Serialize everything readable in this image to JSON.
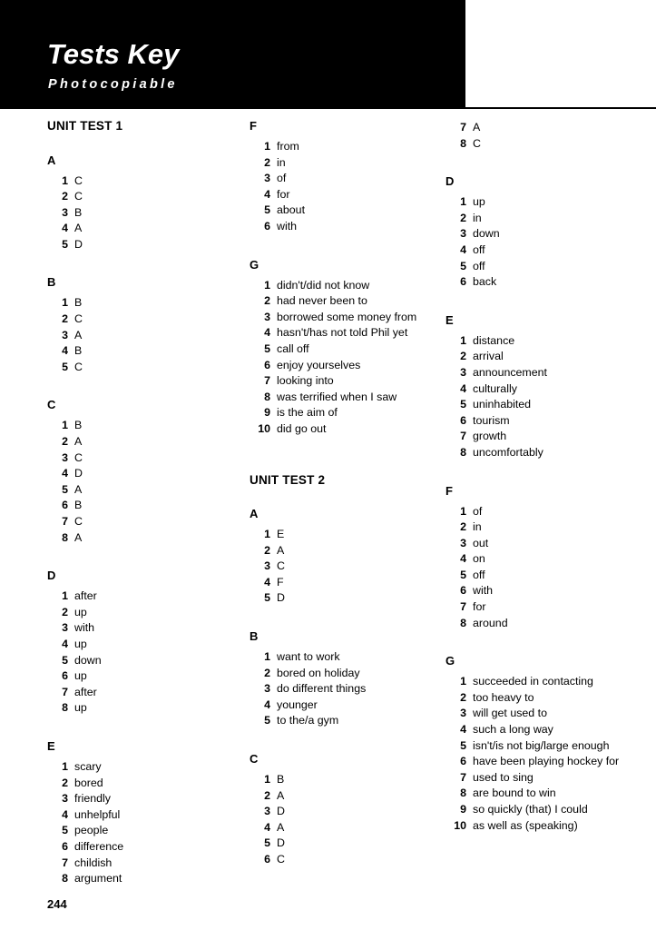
{
  "header": {
    "title": "Tests Key",
    "subtitle": "Photocopiable"
  },
  "page_number": "244",
  "columns": [
    {
      "blocks": [
        {
          "kind": "unit-heading",
          "label": "UNIT TEST 1"
        },
        {
          "kind": "section",
          "letter": "A",
          "items": [
            {
              "num": "1",
              "text": "C"
            },
            {
              "num": "2",
              "text": "C"
            },
            {
              "num": "3",
              "text": "B"
            },
            {
              "num": "4",
              "text": "A"
            },
            {
              "num": "5",
              "text": "D"
            }
          ]
        },
        {
          "kind": "section",
          "letter": "B",
          "items": [
            {
              "num": "1",
              "text": "B"
            },
            {
              "num": "2",
              "text": "C"
            },
            {
              "num": "3",
              "text": "A"
            },
            {
              "num": "4",
              "text": "B"
            },
            {
              "num": "5",
              "text": "C"
            }
          ]
        },
        {
          "kind": "section",
          "letter": "C",
          "items": [
            {
              "num": "1",
              "text": "B"
            },
            {
              "num": "2",
              "text": "A"
            },
            {
              "num": "3",
              "text": "C"
            },
            {
              "num": "4",
              "text": "D"
            },
            {
              "num": "5",
              "text": "A"
            },
            {
              "num": "6",
              "text": "B"
            },
            {
              "num": "7",
              "text": "C"
            },
            {
              "num": "8",
              "text": "A"
            }
          ]
        },
        {
          "kind": "section",
          "letter": "D",
          "items": [
            {
              "num": "1",
              "text": "after"
            },
            {
              "num": "2",
              "text": "up"
            },
            {
              "num": "3",
              "text": "with"
            },
            {
              "num": "4",
              "text": "up"
            },
            {
              "num": "5",
              "text": "down"
            },
            {
              "num": "6",
              "text": "up"
            },
            {
              "num": "7",
              "text": "after"
            },
            {
              "num": "8",
              "text": "up"
            }
          ]
        },
        {
          "kind": "section",
          "letter": "E",
          "items": [
            {
              "num": "1",
              "text": "scary"
            },
            {
              "num": "2",
              "text": "bored"
            },
            {
              "num": "3",
              "text": "friendly"
            },
            {
              "num": "4",
              "text": "unhelpful"
            },
            {
              "num": "5",
              "text": "people"
            },
            {
              "num": "6",
              "text": "difference"
            },
            {
              "num": "7",
              "text": "childish"
            },
            {
              "num": "8",
              "text": "argument"
            }
          ]
        }
      ]
    },
    {
      "blocks": [
        {
          "kind": "section",
          "letter": "F",
          "items": [
            {
              "num": "1",
              "text": "from"
            },
            {
              "num": "2",
              "text": "in"
            },
            {
              "num": "3",
              "text": "of"
            },
            {
              "num": "4",
              "text": "for"
            },
            {
              "num": "5",
              "text": "about"
            },
            {
              "num": "6",
              "text": "with"
            }
          ]
        },
        {
          "kind": "section",
          "letter": "G",
          "items": [
            {
              "num": "1",
              "text": "didn't/did not know"
            },
            {
              "num": "2",
              "text": "had never been to"
            },
            {
              "num": "3",
              "text": "borrowed some money from"
            },
            {
              "num": "4",
              "text": "hasn't/has not told Phil yet"
            },
            {
              "num": "5",
              "text": "call off"
            },
            {
              "num": "6",
              "text": "enjoy yourselves"
            },
            {
              "num": "7",
              "text": "looking into"
            },
            {
              "num": "8",
              "text": "was terrified when I saw"
            },
            {
              "num": "9",
              "text": "is the aim of"
            },
            {
              "num": "10",
              "text": "did go out"
            }
          ]
        },
        {
          "kind": "unit-heading",
          "label": "UNIT TEST 2"
        },
        {
          "kind": "section",
          "letter": "A",
          "items": [
            {
              "num": "1",
              "text": "E"
            },
            {
              "num": "2",
              "text": "A"
            },
            {
              "num": "3",
              "text": "C"
            },
            {
              "num": "4",
              "text": "F"
            },
            {
              "num": "5",
              "text": "D"
            }
          ]
        },
        {
          "kind": "section",
          "letter": "B",
          "items": [
            {
              "num": "1",
              "text": "want to work"
            },
            {
              "num": "2",
              "text": "bored on holiday"
            },
            {
              "num": "3",
              "text": "do different things"
            },
            {
              "num": "4",
              "text": "younger"
            },
            {
              "num": "5",
              "text": "to the/a gym"
            }
          ]
        },
        {
          "kind": "section",
          "letter": "C",
          "items": [
            {
              "num": "1",
              "text": "B"
            },
            {
              "num": "2",
              "text": "A"
            },
            {
              "num": "3",
              "text": "D"
            },
            {
              "num": "4",
              "text": "A"
            },
            {
              "num": "5",
              "text": "D"
            },
            {
              "num": "6",
              "text": "C"
            }
          ]
        }
      ]
    },
    {
      "blocks": [
        {
          "kind": "section-continuation",
          "letter": "",
          "items": [
            {
              "num": "7",
              "text": "A"
            },
            {
              "num": "8",
              "text": "C"
            }
          ]
        },
        {
          "kind": "section",
          "letter": "D",
          "items": [
            {
              "num": "1",
              "text": "up"
            },
            {
              "num": "2",
              "text": "in"
            },
            {
              "num": "3",
              "text": "down"
            },
            {
              "num": "4",
              "text": "off"
            },
            {
              "num": "5",
              "text": "off"
            },
            {
              "num": "6",
              "text": "back"
            }
          ]
        },
        {
          "kind": "section",
          "letter": "E",
          "items": [
            {
              "num": "1",
              "text": "distance"
            },
            {
              "num": "2",
              "text": "arrival"
            },
            {
              "num": "3",
              "text": "announcement"
            },
            {
              "num": "4",
              "text": "culturally"
            },
            {
              "num": "5",
              "text": "uninhabited"
            },
            {
              "num": "6",
              "text": "tourism"
            },
            {
              "num": "7",
              "text": "growth"
            },
            {
              "num": "8",
              "text": "uncomfortably"
            }
          ]
        },
        {
          "kind": "section",
          "letter": "F",
          "items": [
            {
              "num": "1",
              "text": "of"
            },
            {
              "num": "2",
              "text": "in"
            },
            {
              "num": "3",
              "text": "out"
            },
            {
              "num": "4",
              "text": "on"
            },
            {
              "num": "5",
              "text": "off"
            },
            {
              "num": "6",
              "text": "with"
            },
            {
              "num": "7",
              "text": "for"
            },
            {
              "num": "8",
              "text": "around"
            }
          ]
        },
        {
          "kind": "section",
          "letter": "G",
          "items": [
            {
              "num": "1",
              "text": "succeeded in contacting"
            },
            {
              "num": "2",
              "text": "too heavy to"
            },
            {
              "num": "3",
              "text": "will get used to"
            },
            {
              "num": "4",
              "text": "such a long way"
            },
            {
              "num": "5",
              "text": "isn't/is not big/large enough"
            },
            {
              "num": "6",
              "text": "have been playing hockey for"
            },
            {
              "num": "7",
              "text": "used to sing"
            },
            {
              "num": "8",
              "text": "are bound to win"
            },
            {
              "num": "9",
              "text": "so quickly (that) I could"
            },
            {
              "num": "10",
              "text": "as well as (speaking)"
            }
          ]
        }
      ]
    }
  ]
}
